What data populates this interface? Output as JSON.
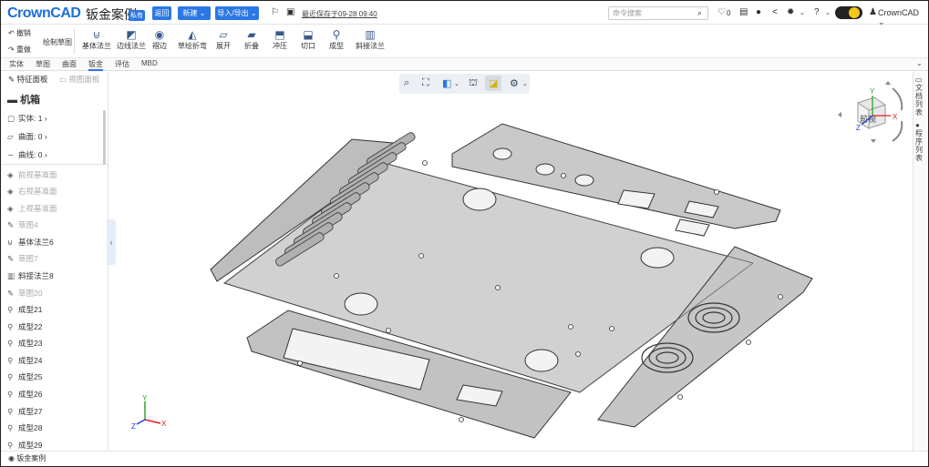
{
  "app": {
    "logo": "CrownCAD",
    "doc_title": "钣金案例",
    "private_badge": "私有",
    "saved": "最近保存于09-28 09:40"
  },
  "header": {
    "back": "返回",
    "new": "新建",
    "import_export": "导入/导出",
    "search_placeholder": "命令搜索",
    "notifications": "0",
    "user": "CrownCAD"
  },
  "ribbon": {
    "undo": "撤销",
    "redo": "重做",
    "sketch": "绘制草图",
    "tools": [
      "基体法兰",
      "边线法兰",
      "褶边",
      "草绘折弯",
      "展开",
      "折叠",
      "冲压",
      "切口",
      "成型",
      "斜接法兰"
    ]
  },
  "tabs": [
    "实体",
    "草图",
    "曲面",
    "钣金",
    "评估",
    "MBD"
  ],
  "active_tab": "钣金",
  "left_panel": {
    "feature_tab": "特征面板",
    "view_tab": "视图面板",
    "model": "机箱",
    "groups": [
      "实体: 1",
      "曲面: 0",
      "曲线: 0"
    ],
    "features": [
      "前视基准面",
      "右视基准面",
      "上视基准面",
      "草图4",
      "基体法兰6",
      "草图7",
      "斜接法兰8",
      "草图20",
      "成型21",
      "成型22",
      "成型23",
      "成型24",
      "成型25",
      "成型26",
      "成型27",
      "成型28",
      "成型29"
    ]
  },
  "right_panel": {
    "docs": "文档列表",
    "procs": "程序列表"
  },
  "status": {
    "doc": "钣金案例"
  },
  "navcube": {
    "face": "前视",
    "x": "X",
    "y": "Y",
    "z": "Z"
  },
  "axes": {
    "x": "X",
    "y": "Y",
    "z": "Z"
  }
}
